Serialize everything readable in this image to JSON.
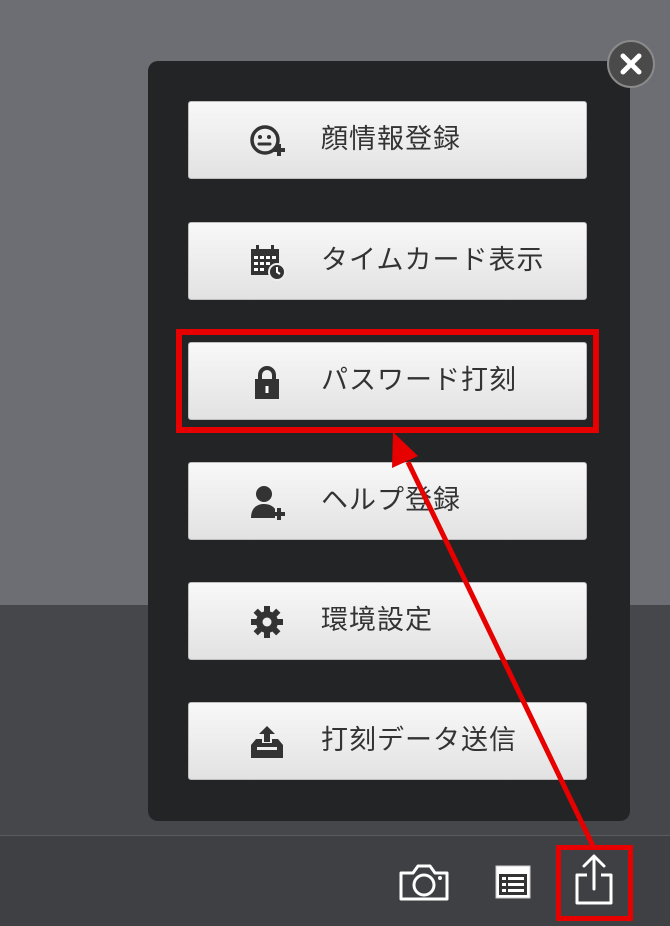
{
  "menu": {
    "items": [
      {
        "label": "顔情報登録",
        "icon": "face-plus-icon"
      },
      {
        "label": "タイムカード表示",
        "icon": "calendar-clock-icon"
      },
      {
        "label": "パスワード打刻",
        "icon": "lock-icon"
      },
      {
        "label": "ヘルプ登録",
        "icon": "user-plus-icon"
      },
      {
        "label": "環境設定",
        "icon": "gear-icon"
      },
      {
        "label": "打刻データ送信",
        "icon": "upload-tray-icon"
      }
    ],
    "close_icon": "close-icon"
  },
  "toolbar": {
    "icons": [
      "camera-icon",
      "list-icon",
      "share-icon"
    ]
  },
  "annotation": {
    "highlight_color": "#e60000"
  }
}
